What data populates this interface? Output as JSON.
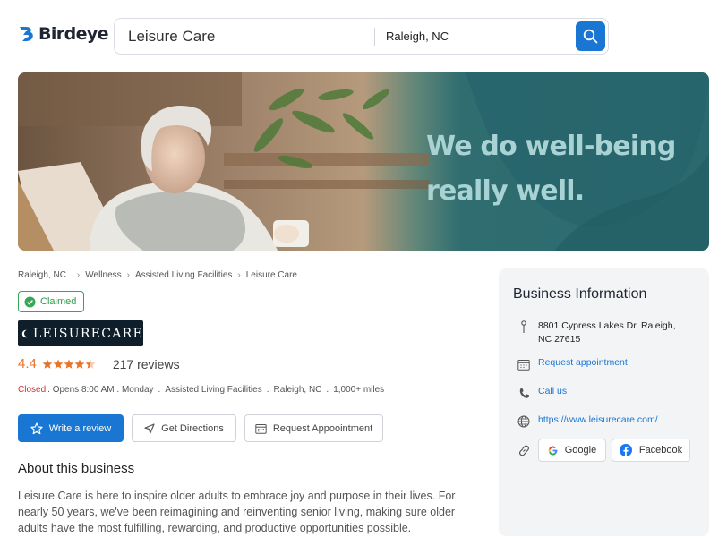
{
  "header": {
    "brand": "Birdeye",
    "search_value": "Leisure Care",
    "location_value": "Raleigh, NC"
  },
  "banner": {
    "headline_line1": "We do well-being",
    "headline_line2": "really well."
  },
  "breadcrumb": [
    "Raleigh, NC",
    "Wellness",
    "Assisted Living Facilities",
    "Leisure Care"
  ],
  "business": {
    "claimed_label": "Claimed",
    "logo_text": "LEISURECARE",
    "rating": "4.4",
    "rating_value": 4.4,
    "rating_max": 5,
    "review_count": "217 reviews",
    "status": "Closed",
    "hours": ". Opens 8:00 AM . Monday",
    "category": "Assisted Living Facilities",
    "location": "Raleigh, NC",
    "distance": "1,000+ miles"
  },
  "actions": {
    "write_review": "Write a review",
    "get_directions": "Get Directions",
    "request_appointment": "Request Appoointment"
  },
  "about": {
    "title": "About this business",
    "text": "Leisure Care is here to inspire older adults to embrace joy and purpose in their lives. For nearly 50 years, we've been reimagining and reinventing senior living, making sure older adults have the most fulfilling, rewarding, and productive opportunities possible."
  },
  "info": {
    "title": "Business Information",
    "address": "8801 Cypress Lakes Dr, Raleigh, NC 27615",
    "appointment": "Request appointment",
    "call": "Call us",
    "website": "https://www.leisurecare.com/",
    "google": "Google",
    "facebook": "Facebook"
  },
  "colors": {
    "accent": "#1976d2",
    "rating": "#e8742b",
    "closed": "#d32f2f",
    "claimed": "#2e9b4a",
    "banner_teal": "#2a6a6f"
  }
}
